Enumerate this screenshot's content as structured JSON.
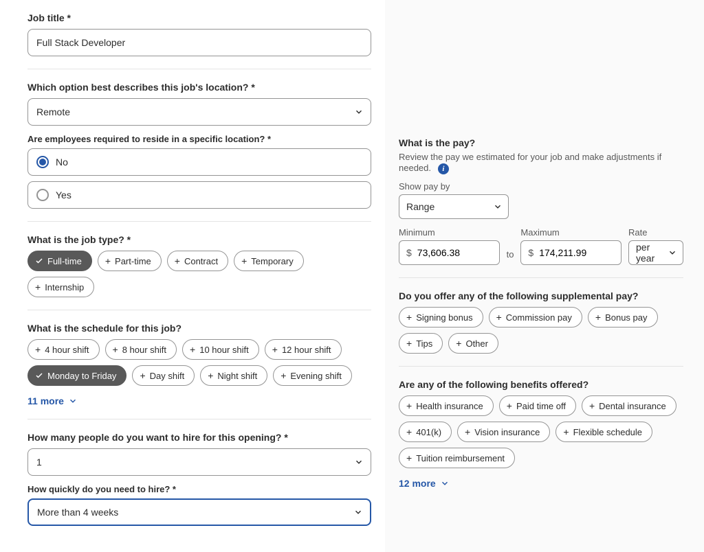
{
  "left": {
    "job_title": {
      "label": "Job title *",
      "value": "Full Stack Developer"
    },
    "location": {
      "label": "Which option best describes this job's location? *",
      "value": "Remote"
    },
    "reside": {
      "label": "Are employees required to reside in a specific location? *",
      "options": [
        {
          "label": "No",
          "checked": true
        },
        {
          "label": "Yes",
          "checked": false
        }
      ]
    },
    "job_type": {
      "label": "What is the job type? *",
      "chips": [
        {
          "label": "Full-time",
          "selected": true
        },
        {
          "label": "Part-time",
          "selected": false
        },
        {
          "label": "Contract",
          "selected": false
        },
        {
          "label": "Temporary",
          "selected": false
        },
        {
          "label": "Internship",
          "selected": false
        }
      ]
    },
    "schedule": {
      "label": "What is the schedule for this job?",
      "chips": [
        {
          "label": "4 hour shift",
          "selected": false
        },
        {
          "label": "8 hour shift",
          "selected": false
        },
        {
          "label": "10 hour shift",
          "selected": false
        },
        {
          "label": "12 hour shift",
          "selected": false
        },
        {
          "label": "Monday to Friday",
          "selected": true
        },
        {
          "label": "Day shift",
          "selected": false
        },
        {
          "label": "Night shift",
          "selected": false
        },
        {
          "label": "Evening shift",
          "selected": false
        }
      ],
      "more": "11 more"
    },
    "hire_count": {
      "label": "How many people do you want to hire for this opening? *",
      "value": "1"
    },
    "hire_speed": {
      "label": "How quickly do you need to hire? *",
      "value": "More than 4 weeks"
    }
  },
  "right": {
    "pay": {
      "title": "What is the pay?",
      "helper": "Review the pay we estimated for your job and make adjustments if needed.",
      "show_pay_by_label": "Show pay by",
      "show_pay_by_value": "Range",
      "min_label": "Minimum",
      "min_value": "73,606.38",
      "to_label": "to",
      "max_label": "Maximum",
      "max_value": "174,211.99",
      "currency": "$",
      "rate_label": "Rate",
      "rate_value": "per year"
    },
    "supplemental": {
      "label": "Do you offer any of the following supplemental pay?",
      "chips": [
        {
          "label": "Signing bonus"
        },
        {
          "label": "Commission pay"
        },
        {
          "label": "Bonus pay"
        },
        {
          "label": "Tips"
        },
        {
          "label": "Other"
        }
      ]
    },
    "benefits": {
      "label": "Are any of the following benefits offered?",
      "chips": [
        {
          "label": "Health insurance"
        },
        {
          "label": "Paid time off"
        },
        {
          "label": "Dental insurance"
        },
        {
          "label": "401(k)"
        },
        {
          "label": "Vision insurance"
        },
        {
          "label": "Flexible schedule"
        },
        {
          "label": "Tuition reimbursement"
        }
      ],
      "more": "12 more"
    }
  }
}
